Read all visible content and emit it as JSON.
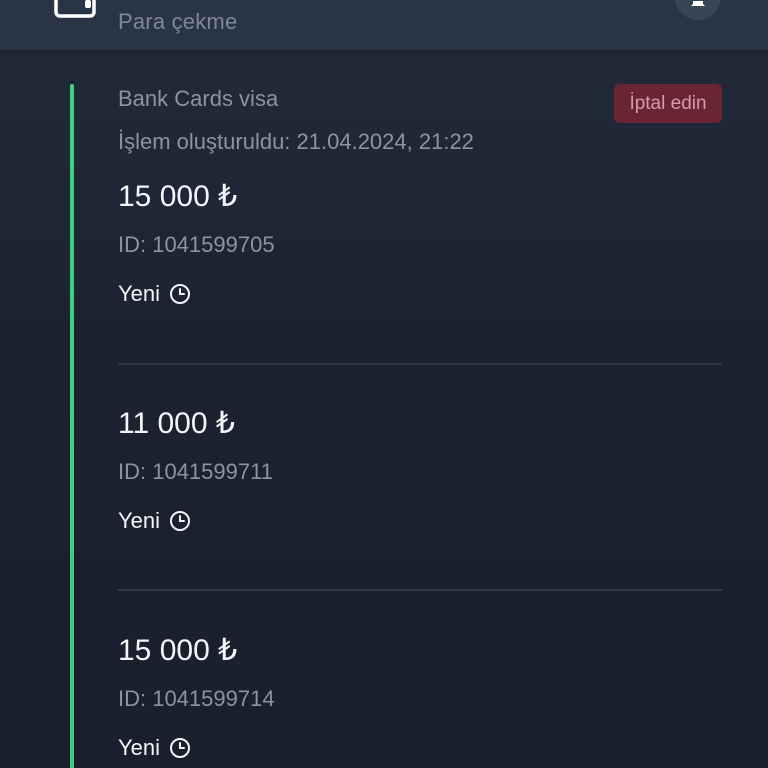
{
  "header": {
    "title": "Para çekme",
    "left_icon": "wallet-icon",
    "right_icon": "bell-icon"
  },
  "card": {
    "method": "Bank Cards visa",
    "created": "İşlem oluşturuldu: 21.04.2024, 21:22",
    "cancel_label": "İptal edin",
    "accent_color": "#3fd07c",
    "cancel_color": "#6a2535"
  },
  "transactions": [
    {
      "amount": "15 000 ₺",
      "id": "ID: 1041599705",
      "status": "Yeni",
      "status_icon": "clock-icon"
    },
    {
      "amount": "11 000 ₺",
      "id": "ID: 1041599711",
      "status": "Yeni",
      "status_icon": "clock-icon"
    },
    {
      "amount": "15 000 ₺",
      "id": "ID: 1041599714",
      "status": "Yeni",
      "status_icon": "clock-icon"
    }
  ]
}
